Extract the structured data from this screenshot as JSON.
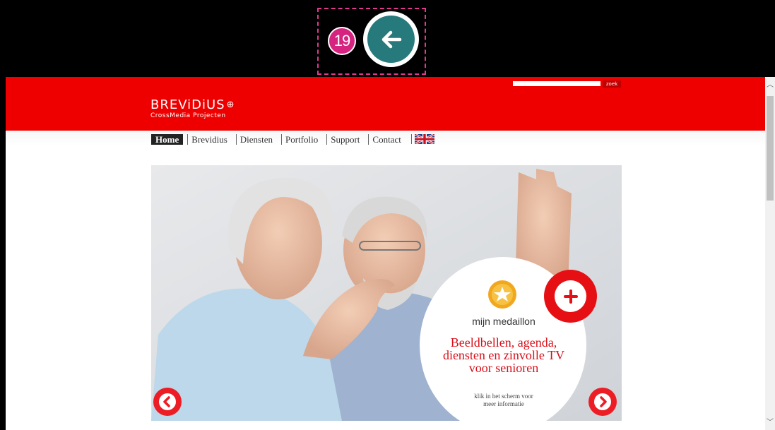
{
  "overlay": {
    "step_number": "19",
    "highlight_color": "#e0398f",
    "back_button_color": "#277a7c",
    "back_icon": "arrow-left-icon"
  },
  "header": {
    "brand_color": "#ee0000",
    "search_button": "zoek",
    "logo_name": "BREViDiUS",
    "logo_tagline": "CrossMedia Projecten"
  },
  "nav": {
    "items": [
      "Home",
      "Brevidius",
      "Diensten",
      "Portfolio",
      "Support",
      "Contact"
    ],
    "language_icon": "uk-flag-icon"
  },
  "hero": {
    "medallion_title": "mijn medaillon",
    "headline_line1": "Beeldbellen, agenda,",
    "headline_line2": "diensten en zinvolle TV",
    "headline_line3": "voor senioren",
    "cta_line1": "klik in het scherm voor",
    "cta_line2": "meer informatie",
    "headline_color": "#d90f1a",
    "prev_icon": "chevron-left-icon",
    "next_icon": "chevron-right-icon",
    "plus_icon": "plus-icon"
  }
}
